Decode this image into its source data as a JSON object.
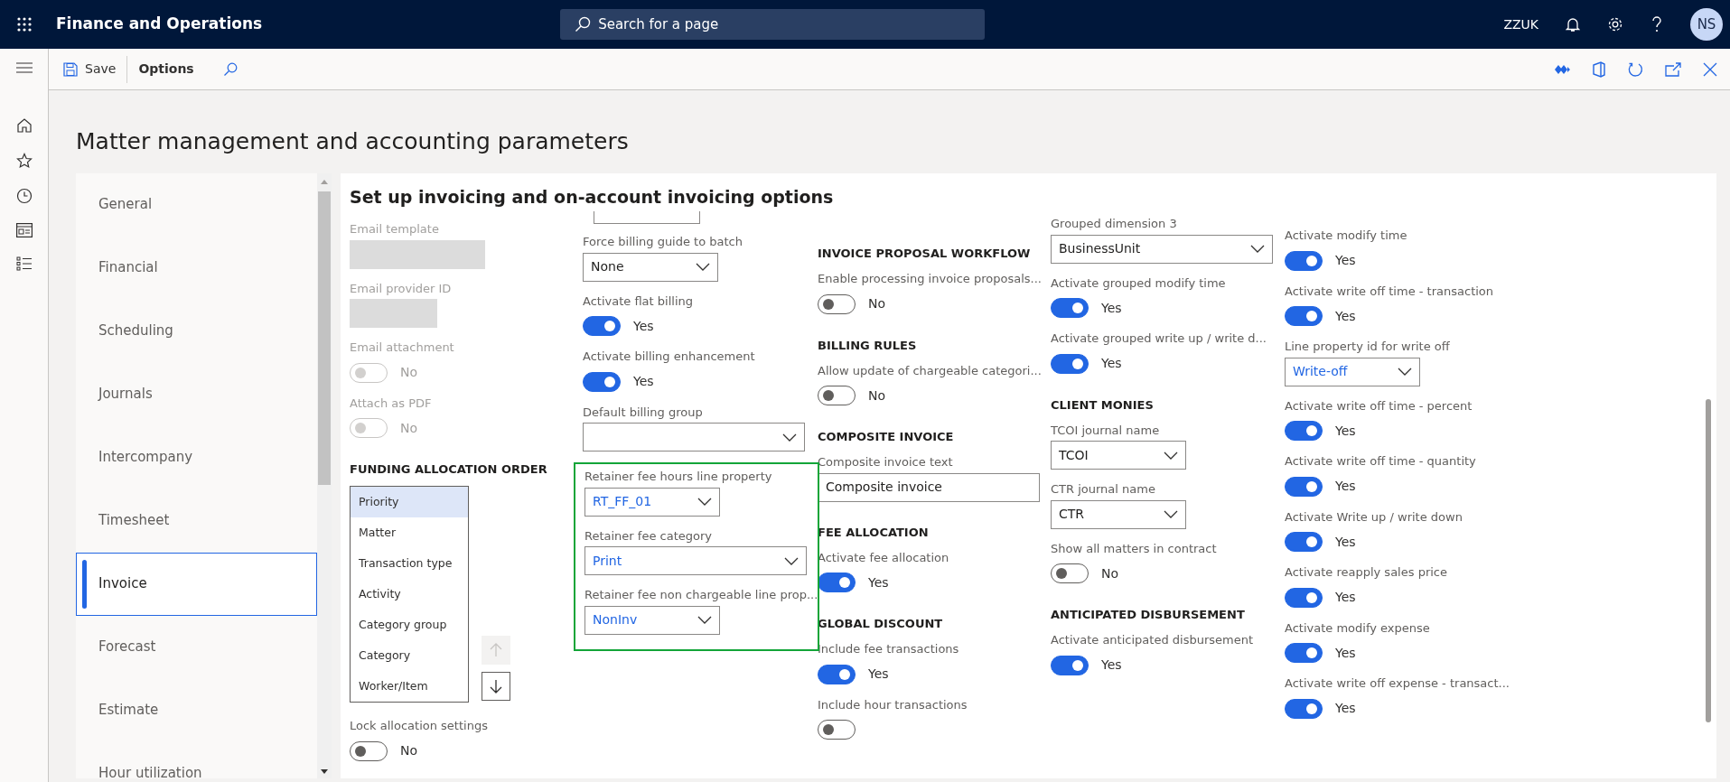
{
  "app_bar": {
    "title": "Finance and Operations",
    "search": {
      "placeholder": "Search for a page"
    },
    "company": "ZZUK",
    "avatar": "NS"
  },
  "toolbar": {
    "save": "Save",
    "options": "Options"
  },
  "page_title": "Matter management and accounting parameters",
  "tabs": [
    {
      "label": "General",
      "selected": false
    },
    {
      "label": "Financial",
      "selected": false
    },
    {
      "label": "Scheduling",
      "selected": false
    },
    {
      "label": "Journals",
      "selected": false
    },
    {
      "label": "Intercompany",
      "selected": false
    },
    {
      "label": "Timesheet",
      "selected": false
    },
    {
      "label": "Invoice",
      "selected": true
    },
    {
      "label": "Forecast",
      "selected": false
    },
    {
      "label": "Estimate",
      "selected": false
    },
    {
      "label": "Hour utilization",
      "selected": false
    }
  ],
  "section_title": "Set up invoicing and on-account invoicing options",
  "columns": [
    [
      {
        "kind": "text",
        "label": "Email template",
        "disabled": true,
        "wide": true
      },
      {
        "kind": "text",
        "label": "Email provider ID",
        "disabled": true,
        "wide": false
      },
      {
        "kind": "toggle",
        "label": "Email attachment",
        "on": false,
        "disabled": true,
        "value": "No"
      },
      {
        "kind": "toggle",
        "label": "Attach as PDF",
        "on": false,
        "disabled": true,
        "value": "No"
      },
      {
        "kind": "heading",
        "label": "FUNDING ALLOCATION ORDER"
      },
      {
        "kind": "listbox",
        "items": [
          {
            "label": "Priority",
            "selected": true
          },
          {
            "label": "Matter",
            "selected": false
          },
          {
            "label": "Transaction type",
            "selected": false
          },
          {
            "label": "Activity",
            "selected": false
          },
          {
            "label": "Category group",
            "selected": false
          },
          {
            "label": "Category",
            "selected": false
          },
          {
            "label": "Worker/Item",
            "selected": false
          }
        ],
        "up_disabled": true,
        "down_disabled": false
      },
      {
        "kind": "toggle",
        "label": "Lock allocation settings",
        "on": false,
        "disabled": false,
        "value": "No"
      }
    ],
    [
      {
        "kind": "cutoff"
      },
      {
        "kind": "select",
        "label": "Force billing guide to batch",
        "value": "None",
        "link": false,
        "wide": false
      },
      {
        "kind": "toggle",
        "label": "Activate flat billing",
        "on": true,
        "disabled": false,
        "value": "Yes"
      },
      {
        "kind": "toggle",
        "label": "Activate billing enhancement",
        "on": true,
        "disabled": false,
        "value": "Yes"
      },
      {
        "kind": "select",
        "label": "Default billing group",
        "wide": true
      },
      {
        "kind": "group",
        "highlighted": true,
        "fields": [
          {
            "kind": "select",
            "label": "Retainer fee hours line property",
            "value": "RT_FF_01",
            "link": true,
            "wide": false
          },
          {
            "kind": "select",
            "label": "Retainer fee category",
            "value": "Print",
            "link": true,
            "wide": true
          },
          {
            "kind": "select",
            "label": "Retainer fee non chargeable line prop...",
            "value": "NonInv",
            "link": true,
            "wide": false
          }
        ]
      }
    ],
    [
      {
        "kind": "heading",
        "label": "INVOICE PROPOSAL WORKFLOW"
      },
      {
        "kind": "toggle",
        "label": "Enable processing invoice proposals...",
        "on": false,
        "disabled": false,
        "value": "No"
      },
      {
        "kind": "heading",
        "label": "BILLING RULES"
      },
      {
        "kind": "toggle",
        "label": "Allow update of chargeable categori...",
        "on": false,
        "disabled": false,
        "value": "No"
      },
      {
        "kind": "heading",
        "label": "COMPOSITE INVOICE"
      },
      {
        "kind": "text",
        "label": "Composite invoice text",
        "value": "Composite invoice",
        "disabled": false,
        "wide": true
      },
      {
        "kind": "heading",
        "label": "FEE ALLOCATION"
      },
      {
        "kind": "toggle",
        "label": "Activate fee allocation",
        "on": true,
        "disabled": false,
        "value": "Yes"
      },
      {
        "kind": "heading",
        "label": "GLOBAL DISCOUNT"
      },
      {
        "kind": "toggle",
        "label": "Include fee transactions",
        "on": true,
        "disabled": false,
        "value": "Yes"
      },
      {
        "kind": "toggle",
        "label": "Include hour transactions",
        "on": false,
        "disabled": false
      }
    ],
    [
      {
        "kind": "select",
        "label": "Grouped dimension 3",
        "value": "BusinessUnit",
        "link": false,
        "wide": true
      },
      {
        "kind": "toggle",
        "label": "Activate grouped modify time",
        "on": true,
        "disabled": false,
        "value": "Yes"
      },
      {
        "kind": "toggle",
        "label": "Activate grouped write up / write d...",
        "on": true,
        "disabled": false,
        "value": "Yes"
      },
      {
        "kind": "heading",
        "label": "CLIENT MONIES"
      },
      {
        "kind": "select",
        "label": "TCOI journal name",
        "value": "TCOI",
        "link": false,
        "wide": false
      },
      {
        "kind": "select",
        "label": "CTR journal name",
        "value": "CTR",
        "link": false,
        "wide": false
      },
      {
        "kind": "toggle",
        "label": "Show all matters in contract",
        "on": false,
        "disabled": false,
        "value": "No"
      },
      {
        "kind": "heading",
        "label": "ANTICIPATED DISBURSEMENT"
      },
      {
        "kind": "toggle",
        "label": "Activate anticipated disbursement",
        "on": true,
        "disabled": false,
        "value": "Yes"
      }
    ],
    [
      {
        "kind": "toggle",
        "label": "Activate modify time",
        "on": true,
        "disabled": false,
        "value": "Yes"
      },
      {
        "kind": "toggle",
        "label": "Activate write off time - transaction",
        "on": true,
        "disabled": false,
        "value": "Yes"
      },
      {
        "kind": "select",
        "label": "Line property id for write off",
        "value": "Write-off",
        "link": true,
        "wide": false
      },
      {
        "kind": "toggle",
        "label": "Activate write off time - percent",
        "on": true,
        "disabled": false,
        "value": "Yes"
      },
      {
        "kind": "toggle",
        "label": "Activate write off time - quantity",
        "on": true,
        "disabled": false,
        "value": "Yes"
      },
      {
        "kind": "toggle",
        "label": "Activate Write up / write down",
        "on": true,
        "disabled": false,
        "value": "Yes"
      },
      {
        "kind": "toggle",
        "label": "Activate reapply sales price",
        "on": true,
        "disabled": false,
        "value": "Yes"
      },
      {
        "kind": "toggle",
        "label": "Activate modify expense",
        "on": true,
        "disabled": false,
        "value": "Yes"
      },
      {
        "kind": "toggle",
        "label": "Activate write off expense - transact...",
        "on": true,
        "disabled": false,
        "value": "Yes"
      }
    ]
  ]
}
